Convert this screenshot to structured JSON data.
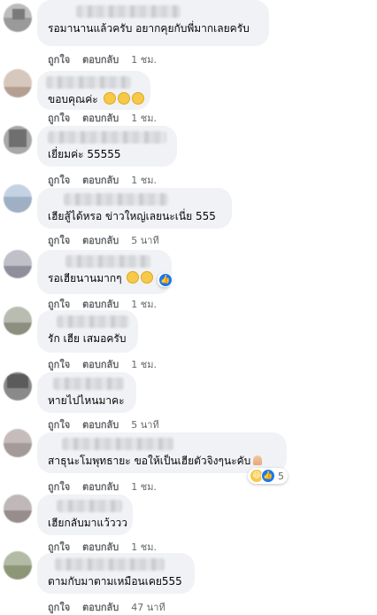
{
  "labels": {
    "like": "ถูกใจ",
    "reply": "ตอบกลับ"
  },
  "comments": [
    {
      "text": "รอมานานแล้วครับ อยากคุยกับพี่มากเลยครับ",
      "time": "1 ชม."
    },
    {
      "text": "ขอบคุณค่ะ",
      "time": "1 ชม.",
      "emoji": "😁😁😁"
    },
    {
      "text": "เยี่ยมค่ะ 55555",
      "time": "1 ชม."
    },
    {
      "text": "เฮียสู้ได้หรอ ข่าวใหญ่เลยนะเนี่ย 555",
      "time": "5 นาที"
    },
    {
      "text": "รอเฮียนานมากๆ",
      "time": "1 ชม.",
      "emoji": "🤣🤣",
      "reaction_icons": [
        "like-icon"
      ]
    },
    {
      "text": "รัก เฮีย เสมอครับ",
      "time": "1 ชม."
    },
    {
      "text": "หายไปไหนมาคะ",
      "time": "5 นาที"
    },
    {
      "text": "สาธุนะโมพุทธายะ ขอให้เป็นเฮียตัวจิงๆนะคับ",
      "time": "1 ชม.",
      "emoji": "🙏",
      "reaction_icons": [
        "haha-icon",
        "like-icon"
      ],
      "reaction_count": "5"
    },
    {
      "text": "เฮียกลับมาแว้ววว",
      "time": "1 ชม."
    },
    {
      "text": "ตามกับมาตามเหมือนเคย555",
      "time": "47 นาที"
    }
  ],
  "colors": {
    "bubble": "#f0f2f5",
    "meta": "#65676b",
    "like": "#1877f2"
  }
}
